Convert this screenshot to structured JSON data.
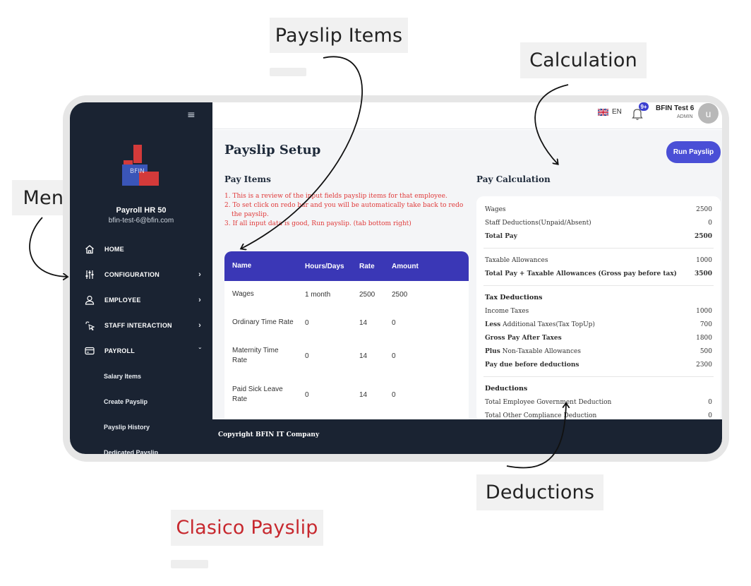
{
  "callouts": {
    "payslip_items": "Payslip Items",
    "calculation": "Calculation",
    "menu": "Menu",
    "deductions": "Deductions",
    "title": "Clasico Payslip"
  },
  "colors": {
    "sidebar": "#1a2332",
    "accent": "#4a4fd6",
    "table_header": "#3a37b6",
    "instruction_text": "#e03a3a",
    "callout_title": "#c7282e"
  },
  "sidebar": {
    "logo_text": "BFIN",
    "company": "Payroll HR 50",
    "email": "bfin-test-6@bfin.com",
    "menu": [
      {
        "label": "HOME",
        "icon": "home-icon"
      },
      {
        "label": "CONFIGURATION",
        "icon": "sliders-icon"
      },
      {
        "label": "EMPLOYEE",
        "icon": "user-icon"
      },
      {
        "label": "STAFF INTERACTION",
        "icon": "pointer-click-icon"
      },
      {
        "label": "PAYROLL",
        "icon": "card-icon"
      }
    ],
    "payroll_sub": [
      "Salary Items",
      "Create Payslip",
      "Payslip History",
      "Dedicated Payslip"
    ]
  },
  "topbar": {
    "language": "EN",
    "notifications": "9+",
    "user_name": "BFIN Test 6",
    "user_role": "ADMIN",
    "avatar_letter": "u"
  },
  "main": {
    "page_title": "Payslip Setup",
    "run_button": "Run Payslip",
    "pay_items_title": "Pay Items",
    "instructions": [
      "1. This is a review of the input fields payslip items for that employee.",
      "2. To set click on redo bar and you will be automatically take back to redo the payslip.",
      "3. If all input data is good, Run payslip. (tab bottom right)"
    ],
    "table": {
      "headers": [
        "Name",
        "Hours/Days",
        "Rate",
        "Amount"
      ],
      "rows": [
        [
          "Wages",
          "1 month",
          "2500",
          "2500"
        ],
        [
          "Ordinary Time Rate",
          "0",
          "14",
          "0"
        ],
        [
          "Maternity Time Rate",
          "0",
          "14",
          "0"
        ],
        [
          "Paid Sick Leave Rate",
          "0",
          "14",
          "0"
        ]
      ]
    },
    "pay_calc_title": "Pay Calculation",
    "calc": {
      "wages_label": "Wages",
      "wages": "2500",
      "staff_ded_label": "Staff Deductions(Unpaid/Absent)",
      "staff_ded": "0",
      "total_pay_label": "Total Pay",
      "total_pay": "2500",
      "taxable_allow_label": "Taxable Allowances",
      "taxable_allow": "1000",
      "gross_label": "Total Pay + Taxable Allowances (Gross pay before tax)",
      "gross": "3500",
      "tax_head": "Tax Deductions",
      "income_tax_label": "Income Taxes",
      "income_tax": "1000",
      "less_word": "Less",
      "additional_tax_label": "Additional Taxes(Tax TopUp)",
      "additional_tax": "700",
      "gross_after_label": "Gross Pay After Taxes",
      "gross_after": "1800",
      "plus_word": "Plus",
      "non_taxable_label": "Non-Taxable Allowances",
      "non_taxable": "500",
      "pay_due_label": "Pay due before deductions",
      "pay_due": "2300",
      "ded_head": "Deductions",
      "emp_gov_label": "Total Employee Government Deduction",
      "emp_gov": "0",
      "other_label": "Total Other Compliance Deduction",
      "other": "0"
    }
  },
  "footer": {
    "copyright": "Copyright BFIN IT Company"
  }
}
